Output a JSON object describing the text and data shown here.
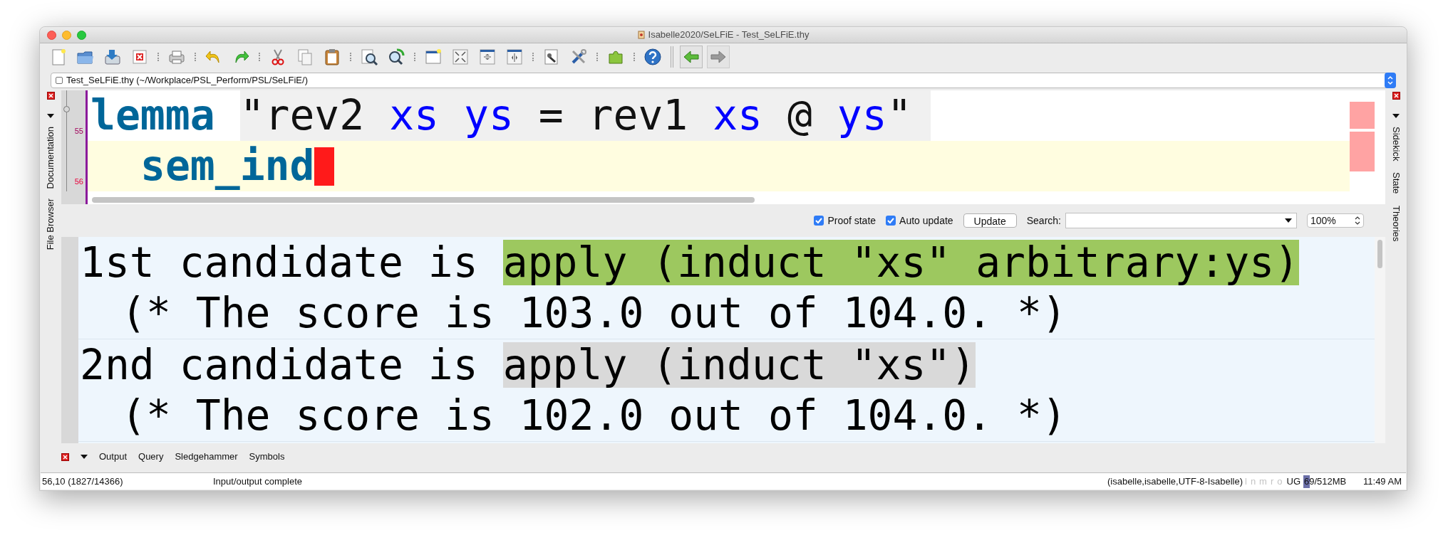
{
  "window": {
    "title": "Isabelle2020/SeLFiE - Test_SeLFiE.thy"
  },
  "buffer": {
    "label": "Test_SeLFiE.thy (~/Workplace/PSL_Perform/PSL/SeLFiE/)"
  },
  "left_dock": {
    "tabs": [
      "Documentation",
      "File Browser"
    ]
  },
  "right_dock": {
    "tabs": [
      "Sidekick",
      "State",
      "Theories"
    ]
  },
  "editor": {
    "lines": [
      {
        "number": "55",
        "current": false,
        "tokens": [
          {
            "kind": "keyword",
            "text": "lemma"
          },
          {
            "kind": "prop",
            "text": "\"rev2 "
          },
          {
            "kind": "var",
            "text": "xs"
          },
          {
            "kind": "var",
            "text": "ys"
          },
          {
            "kind": "prop",
            "text": " = rev1 "
          },
          {
            "kind": "var",
            "text": "xs"
          },
          {
            "kind": "prop",
            "text": " @ "
          },
          {
            "kind": "var",
            "text": "ys"
          },
          {
            "kind": "prop",
            "text": "\""
          }
        ]
      },
      {
        "number": "56",
        "current": true,
        "tokens": [
          {
            "kind": "method",
            "text": "sem_ind"
          }
        ]
      }
    ]
  },
  "output_toolbar": {
    "proof_state": {
      "label": "Proof state",
      "checked": true
    },
    "auto_update": {
      "label": "Auto update",
      "checked": true
    },
    "update_button": "Update",
    "search_label": "Search:",
    "zoom": "100%"
  },
  "output": {
    "entries": [
      {
        "candidate": "1st candidate is",
        "command": "apply (induct \"xs\" arbitrary:ys)",
        "color": "#9dc85f",
        "score": "(* The score is 103.0 out of 104.0. *)"
      },
      {
        "candidate": "2nd candidate is",
        "command": "apply (induct \"xs\")",
        "color": "#d9d9d9",
        "score": "(* The score is 102.0 out of 104.0. *)"
      }
    ]
  },
  "bottom_tabs": [
    "Output",
    "Query",
    "Sledgehammer",
    "Symbols"
  ],
  "status_bar": {
    "position": "56,10 (1827/14366)",
    "message": "Input/output complete",
    "mode": "(isabelle,isabelle,UTF-8-Isabelle)",
    "flags": [
      {
        "label": "l",
        "on": false
      },
      {
        "label": "n",
        "on": false
      },
      {
        "label": "m",
        "on": false
      },
      {
        "label": "r",
        "on": false
      },
      {
        "label": "o",
        "on": false
      }
    ],
    "encoding_flags": "UG",
    "memory": {
      "text": "69/512MB",
      "level": 0.13
    },
    "clock": "11:49 AM"
  }
}
